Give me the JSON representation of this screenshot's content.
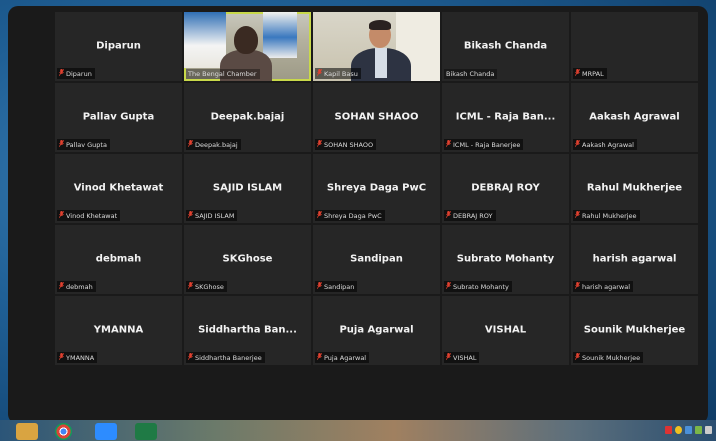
{
  "participants": [
    {
      "name": "Diparun",
      "label": "Diparun",
      "muted": true
    },
    {
      "name": "",
      "label": "The Bengal Chamber",
      "muted": false,
      "video": "bengal",
      "active": true
    },
    {
      "name": "",
      "label": "Kapil Basu",
      "muted": true,
      "video": "kapil"
    },
    {
      "name": "Bikash Chanda",
      "label": "Bikash Chanda",
      "muted": false
    },
    {
      "name": "",
      "label": "MRPAL",
      "muted": true
    },
    {
      "name": "Pallav Gupta",
      "label": "Pallav Gupta",
      "muted": true
    },
    {
      "name": "Deepak.bajaj",
      "label": "Deepak.bajaj",
      "muted": true
    },
    {
      "name": "SOHAN SHAOO",
      "label": "SOHAN SHAOO",
      "muted": true
    },
    {
      "name": "ICML - Raja Ban...",
      "label": "ICML - Raja Banerjee",
      "muted": true
    },
    {
      "name": "Aakash Agrawal",
      "label": "Aakash Agrawal",
      "muted": true
    },
    {
      "name": "Vinod Khetawat",
      "label": "Vinod Khetawat",
      "muted": true
    },
    {
      "name": "SAJID ISLAM",
      "label": "SAJID ISLAM",
      "muted": true
    },
    {
      "name": "Shreya Daga PwC",
      "label": "Shreya Daga PwC",
      "muted": true
    },
    {
      "name": "DEBRAJ ROY",
      "label": "DEBRAJ ROY",
      "muted": true
    },
    {
      "name": "Rahul Mukherjee",
      "label": "Rahul Mukherjee",
      "muted": true
    },
    {
      "name": "debmah",
      "label": "debmah",
      "muted": true
    },
    {
      "name": "SKGhose",
      "label": "SKGhose",
      "muted": true
    },
    {
      "name": "Sandipan",
      "label": "Sandipan",
      "muted": true
    },
    {
      "name": "Subrato Mohanty",
      "label": "Subrato Mohanty",
      "muted": true
    },
    {
      "name": "harish agarwal",
      "label": "harish agarwal",
      "muted": true
    },
    {
      "name": "YMANNA",
      "label": "YMANNA",
      "muted": true
    },
    {
      "name": "Siddhartha Ban...",
      "label": "Siddhartha Banerjee",
      "muted": true
    },
    {
      "name": "Puja Agarwal",
      "label": "Puja Agarwal",
      "muted": true
    },
    {
      "name": "VISHAL",
      "label": "VISHAL",
      "muted": true
    },
    {
      "name": "Sounik Mukherjee",
      "label": "Sounik Mukherjee",
      "muted": true
    }
  ],
  "colors": {
    "mute": "#e0402f",
    "active_border": "#c9d94a",
    "tile": "#262626"
  },
  "taskbar": {
    "icons": [
      "windows-start-icon",
      "chrome-icon",
      "zoom-icon",
      "excel-icon"
    ]
  }
}
